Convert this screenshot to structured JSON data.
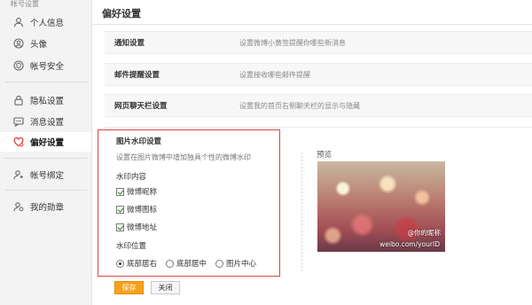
{
  "sidebar": {
    "group_title": "帐号设置",
    "items": [
      {
        "label": "个人信息",
        "icon": "person-icon"
      },
      {
        "label": "头像",
        "icon": "avatar-icon"
      },
      {
        "label": "帐号安全",
        "icon": "shield-icon"
      },
      {
        "label": "隐私设置",
        "icon": "lock-icon"
      },
      {
        "label": "消息设置",
        "icon": "message-icon"
      },
      {
        "label": "偏好设置",
        "icon": "heart-gear-icon",
        "active": true
      },
      {
        "label": "帐号绑定",
        "icon": "person-link-icon"
      },
      {
        "label": "我的勋章",
        "icon": "medal-icon"
      }
    ]
  },
  "main": {
    "title": "偏好设置",
    "rows": [
      {
        "title": "通知设置",
        "desc": "设置微博小黄签提醒你哪些新消息"
      },
      {
        "title": "邮件提醒设置",
        "desc": "设置接收哪些邮件提醒"
      },
      {
        "title": "网页聊天栏设置",
        "desc": "设置我的首页右侧聊天栏的显示与隐藏"
      }
    ],
    "watermark": {
      "title": "图片水印设置",
      "desc": "设置在图片微博中增加独具个性的微博水印",
      "content_label": "水印内容",
      "options": [
        {
          "label": "微博昵称",
          "checked": true
        },
        {
          "label": "微博图标",
          "checked": true
        },
        {
          "label": "微博地址",
          "checked": true
        }
      ],
      "position_label": "水印位置",
      "positions": [
        {
          "label": "底部居右",
          "checked": true
        },
        {
          "label": "底部居中",
          "checked": false
        },
        {
          "label": "图片中心",
          "checked": false
        }
      ],
      "save_label": "保存",
      "close_label": "关闭",
      "preview_label": "预览",
      "preview_watermark_name": "@你的昵称",
      "preview_watermark_url": "weibo.com/yourID"
    }
  },
  "colors": {
    "accent": "#f7a21b",
    "active_icon": "#e0403a",
    "highlight": "#d9463f"
  }
}
